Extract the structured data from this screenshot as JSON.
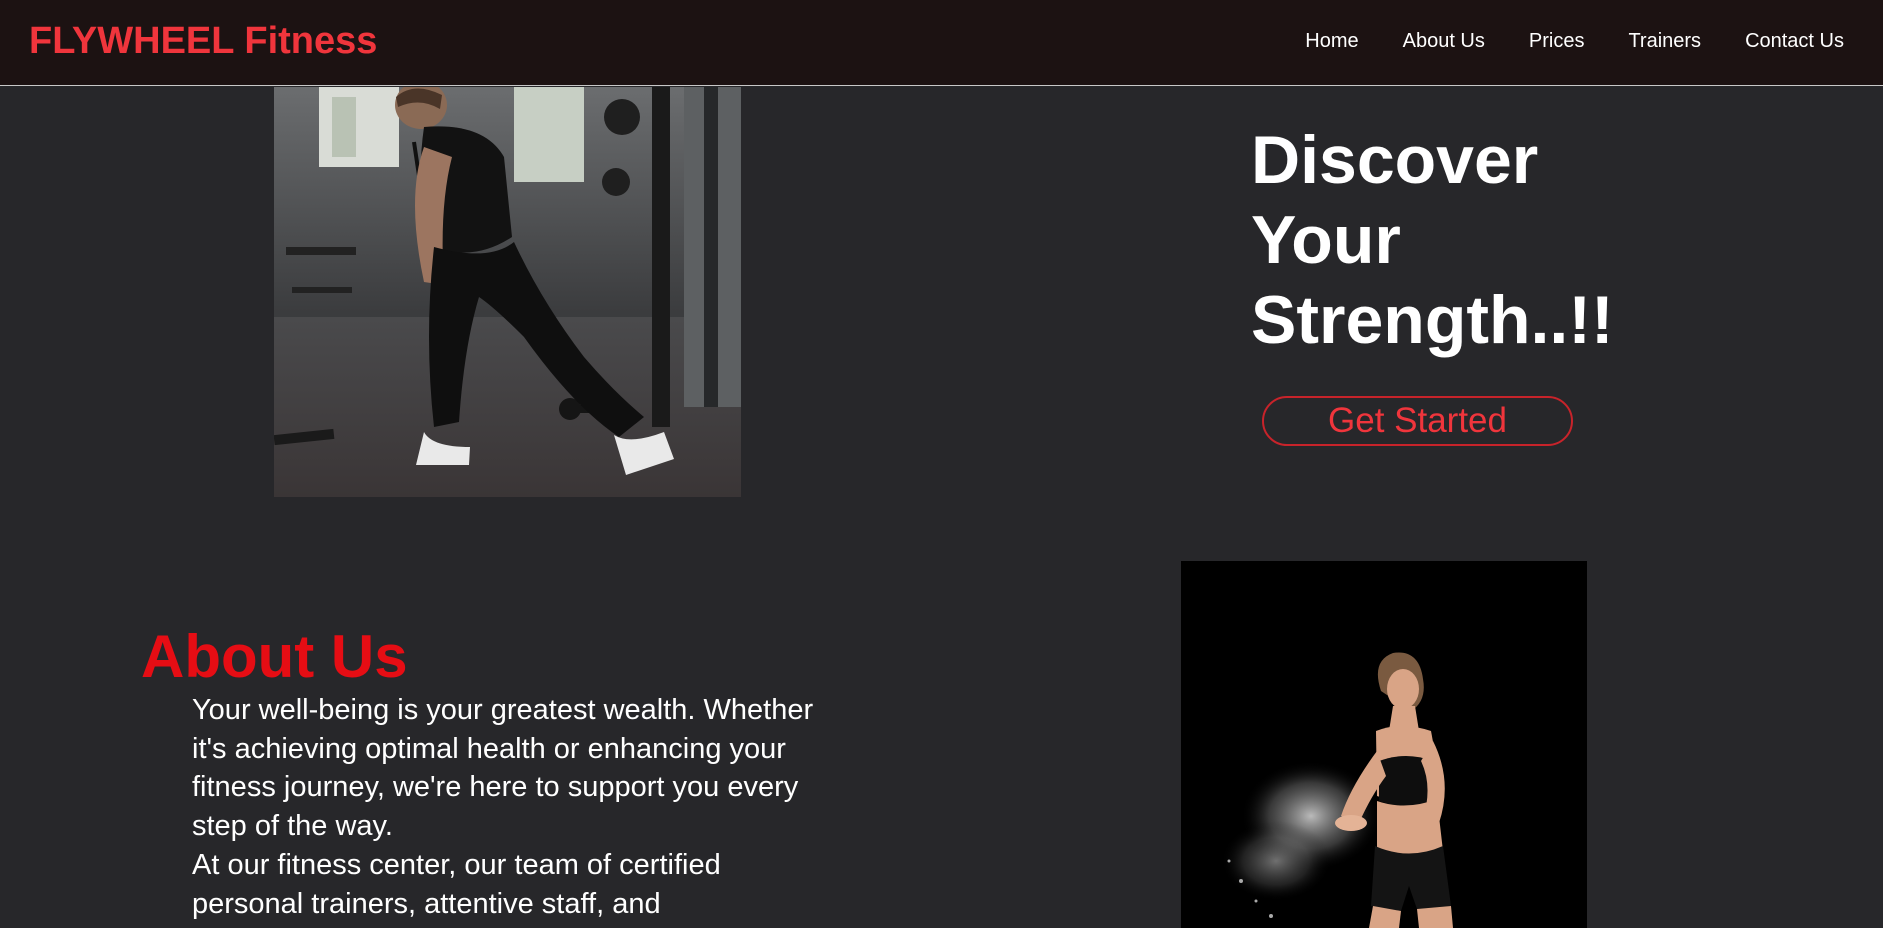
{
  "brand": {
    "name": "FLYWHEEL Fitness"
  },
  "nav": {
    "items": [
      {
        "label": "Home"
      },
      {
        "label": "About Us"
      },
      {
        "label": "Prices"
      },
      {
        "label": "Trainers"
      },
      {
        "label": "Contact Us"
      }
    ]
  },
  "hero": {
    "title": "Discover Your Strength..!!",
    "cta_label": "Get Started",
    "image": "man-cable-workout-photo"
  },
  "about": {
    "heading": "About Us",
    "paragraphs": [
      "Your well-being is your greatest wealth. Whether it's achieving optimal health or enhancing your fitness journey, we're here to support you every step of the way.",
      "At our fitness center, our team of certified personal trainers, attentive staff, and"
    ],
    "image": "woman-chalk-hands-photo"
  },
  "colors": {
    "accent": "#f0353c",
    "heading_red": "#e60d14",
    "background": "#27272a",
    "navbar": "#1c1212"
  }
}
